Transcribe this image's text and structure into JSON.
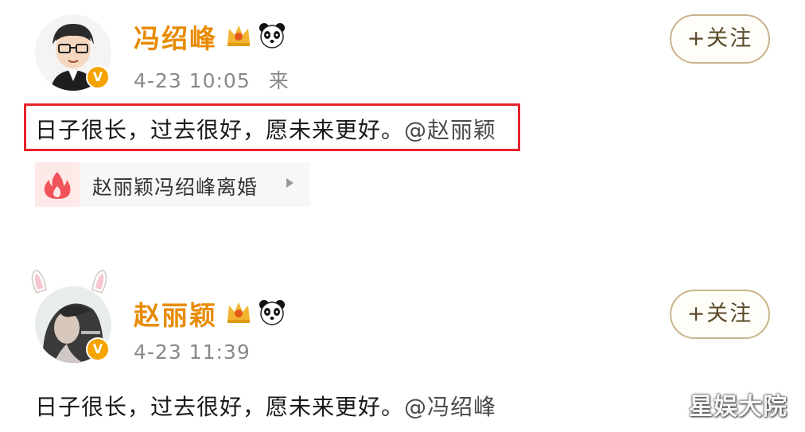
{
  "posts": [
    {
      "username": "冯绍峰",
      "timestamp": "4-23 10:05",
      "source": "来",
      "follow_label": "+关注",
      "text": "日子很长，过去很好，愿未来更好。",
      "mention": "@赵丽颖",
      "badge_letter": "V",
      "topic": {
        "label": "赵丽颖冯绍峰离婚",
        "icon": "fire-icon"
      },
      "highlighted": true
    },
    {
      "username": "赵丽颖",
      "timestamp": "4-23 11:39",
      "follow_label": "+关注",
      "text": "日子很长，过去很好，愿未来更好。",
      "mention": "@冯绍峰",
      "badge_letter": "V",
      "highlighted": false
    }
  ],
  "watermark": "星娱大院",
  "colors": {
    "username": "#e88b00",
    "highlight_border": "#e5232c",
    "verified_badge": "#f6a300",
    "follow_border": "#c9b48a"
  },
  "icons": {
    "crown": "crown-icon",
    "panda": "panda-icon",
    "arrow": "triangle-right-icon"
  }
}
